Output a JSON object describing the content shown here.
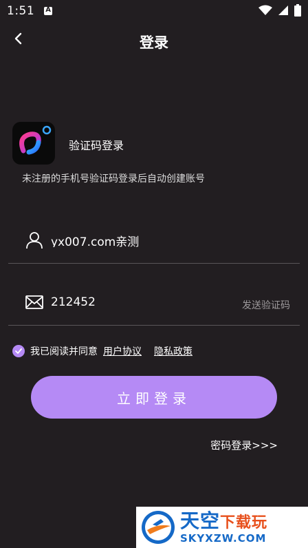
{
  "status_bar": {
    "time": "1:51"
  },
  "header": {
    "title": "登录"
  },
  "intro": {
    "heading": "验证码登录",
    "hint": "未注册的手机号验证码登录后自动创建账号"
  },
  "form": {
    "phone_value": "yx007.com亲测",
    "code_value": "212452",
    "send_code_label": "发送验证码"
  },
  "agreement": {
    "text": "我已阅读并同意",
    "user_agreement": "用户协议",
    "privacy_policy": "隐私政策",
    "checked": true
  },
  "login_button": "立即登录",
  "password_login": "密码登录>>>",
  "watermark": {
    "title_main": "天空",
    "title_accent": "下载玩",
    "url": "SKYXZW.COM"
  },
  "colors": {
    "background": "#221e21",
    "accent": "#b58af5",
    "muted": "#9d999c"
  }
}
